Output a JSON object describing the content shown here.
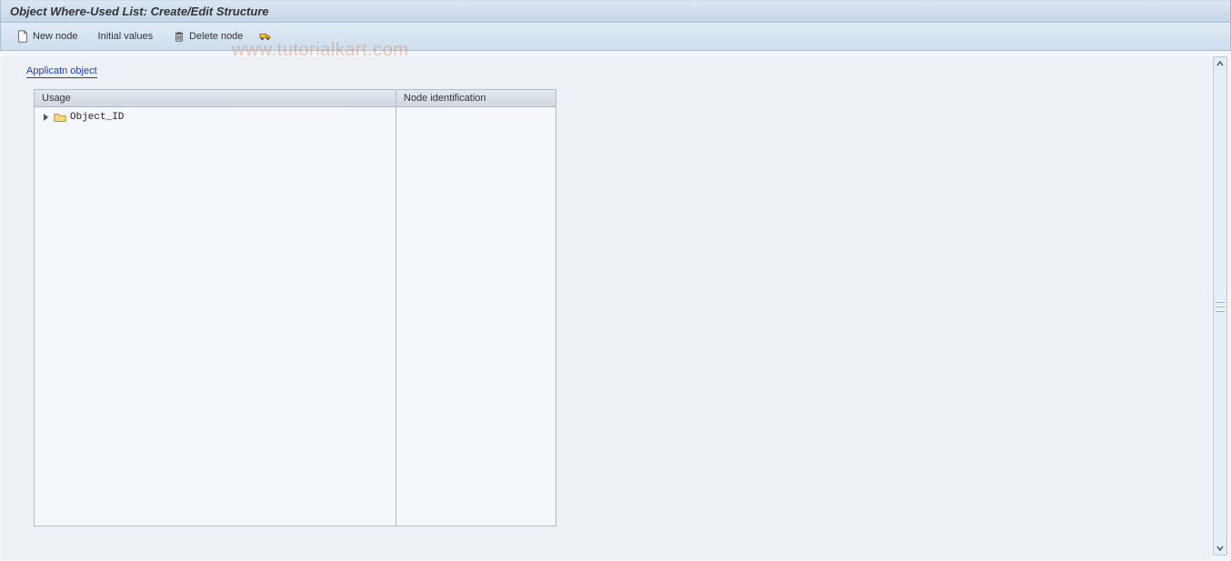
{
  "header": {
    "title": "Object Where-Used List: Create/Edit Structure"
  },
  "toolbar": {
    "new_node": "New node",
    "initial_values": "Initial values",
    "delete_node": "Delete node"
  },
  "content": {
    "application_link": "Applicatn object",
    "columns": {
      "usage": "Usage",
      "node_id": "Node identification"
    },
    "tree": {
      "root_label": "Object_ID"
    }
  },
  "watermark": "www.tutorialkart.com"
}
